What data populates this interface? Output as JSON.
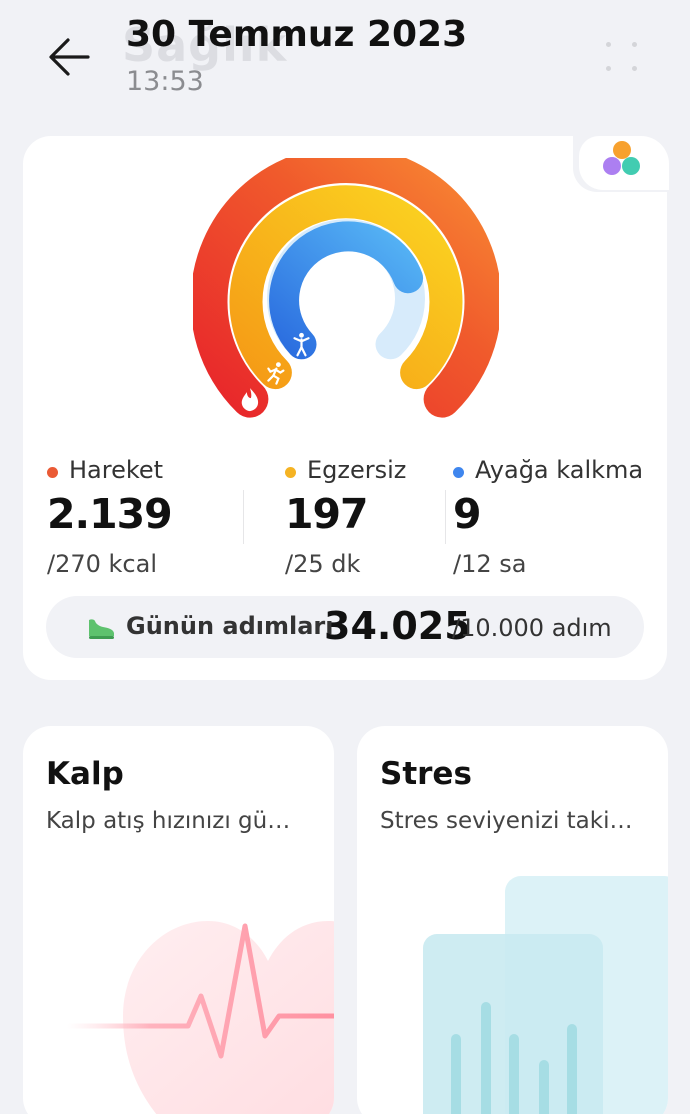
{
  "header": {
    "ghost_title": "Sağlık",
    "date": "30 Temmuz 2023",
    "time": "13:53"
  },
  "activity": {
    "stats": [
      {
        "label": "Hareket",
        "value": "2.139",
        "goal": "/270 kcal",
        "color": "#ea5a35"
      },
      {
        "label": "Egzersiz",
        "value": "197",
        "goal": "/25 dk",
        "color": "#f5b323"
      },
      {
        "label": "Ayağa kalkma",
        "value": "9",
        "goal": "/12 sa",
        "color": "#3f86ee"
      }
    ],
    "steps": {
      "label": "Günün adımları",
      "value": "34.025",
      "goal": "/10.000 adım",
      "color": "#5ec26e"
    }
  },
  "cards": [
    {
      "title": "Kalp",
      "subtitle": "Kalp atış hızınızı gü…"
    },
    {
      "title": "Stres",
      "subtitle": "Stres seviyenizi taki…"
    }
  ],
  "icons": {
    "back": "arrow-left-icon",
    "more": "dots-grid-icon",
    "rings": "activity-rings-icon",
    "move": "flame-icon",
    "exercise": "running-person-icon",
    "stand": "standing-person-icon",
    "steps": "shoe-icon"
  }
}
